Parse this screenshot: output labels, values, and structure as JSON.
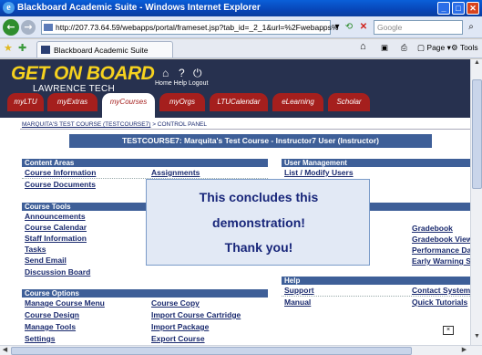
{
  "window": {
    "title": "Blackboard Academic Suite - Windows Internet Explorer",
    "min": "_",
    "max": "□",
    "close": "✕"
  },
  "addressbar": {
    "url": "http://207.73.64.59/webapps/portal/frameset.jsp?tab_id=_2_1&url=%2Fwebapps%",
    "search_placeholder": "Google"
  },
  "tabbar": {
    "tab_label": "Blackboard Academic Suite",
    "page_label": "Page",
    "tools_label": "Tools"
  },
  "banner": {
    "logo_line1": "GET ON BOARD",
    "logo_line2": "LAWRENCE TECH",
    "links": [
      "Home",
      "Help",
      "Logout"
    ],
    "tabs": [
      {
        "label": "myLTU",
        "active": false
      },
      {
        "label": "myExtras",
        "active": false
      },
      {
        "label": "myCourses",
        "active": true
      },
      {
        "label": "myOrgs",
        "active": false
      },
      {
        "label": "LTUCalendar",
        "active": false
      },
      {
        "label": "eLearning",
        "active": false
      },
      {
        "label": "Scholar",
        "active": false
      }
    ]
  },
  "breadcrumb": {
    "course": "MARQUITA'S TEST COURSE (TESTCOURSE7)",
    "sep": ">",
    "current": "CONTROL PANEL"
  },
  "course_title": "TESTCOURSE7: Marquita's Test Course - Instructor7 User (Instructor)",
  "sections": {
    "content_areas": {
      "title": "Content Areas",
      "links": [
        "Course Information",
        "Course Documents",
        "Assignments"
      ]
    },
    "course_tools": {
      "title": "Course Tools",
      "links": [
        "Announcements",
        "Course Calendar",
        "Staff Information",
        "Tasks",
        "Send Email",
        "Discussion Board"
      ]
    },
    "course_options": {
      "title": "Course Options",
      "links": [
        "Manage Course Menu",
        "Course Design",
        "Manage Tools",
        "Settings",
        "Course Copy",
        "Import Course Cartridge",
        "Import Package",
        "Export Course"
      ]
    },
    "user_management": {
      "title": "User Management",
      "links": [
        "List / Modify Users"
      ]
    },
    "assessment": {
      "links": [
        "Gradebook",
        "Gradebook Views",
        "Performance Das",
        "Early Warning Sy"
      ]
    },
    "help": {
      "title": "Help",
      "links": [
        "Support",
        "Manual",
        "Contact System A",
        "Quick Tutorials"
      ]
    }
  },
  "overlay": {
    "line1": "This concludes this",
    "line2": "demonstration!",
    "line3": "Thank you!"
  }
}
